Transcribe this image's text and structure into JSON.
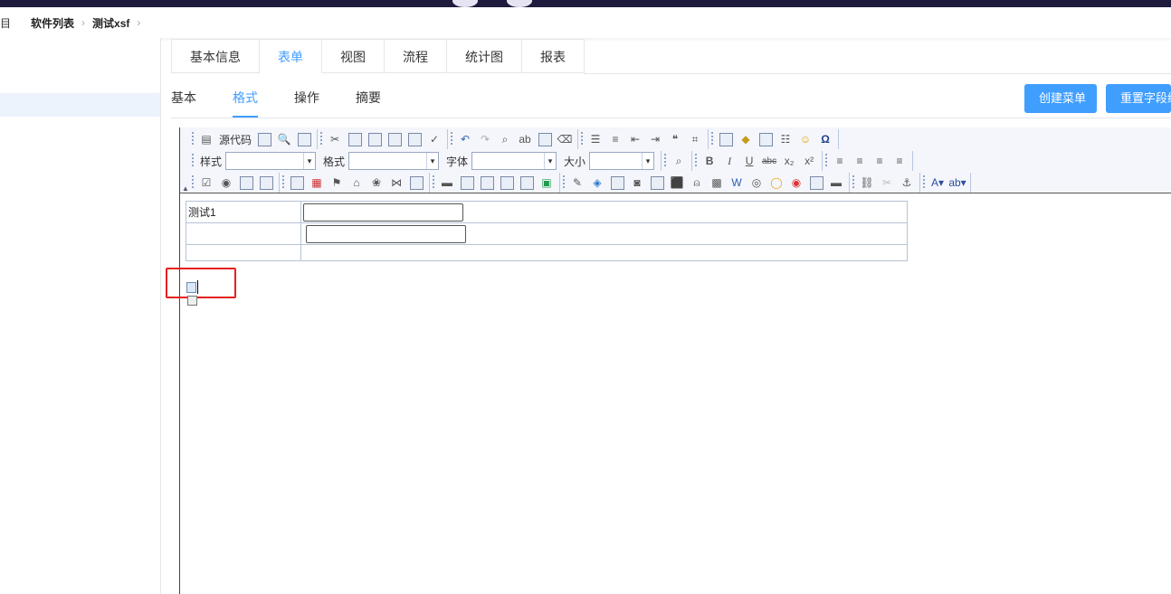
{
  "breadcrumb": {
    "first": "目",
    "items": [
      "软件列表",
      "测试xsf"
    ]
  },
  "tabs_primary": [
    "基本信息",
    "表单",
    "视图",
    "流程",
    "统计图",
    "报表"
  ],
  "tabs_primary_active": "表单",
  "tabs_secondary": [
    "基本",
    "格式",
    "操作",
    "摘要"
  ],
  "tabs_secondary_active": "格式",
  "buttons": {
    "create_menu": "创建菜单",
    "reset_fields": "重置字段编"
  },
  "toolbar": {
    "source_label": "源代码",
    "style_label": "样式",
    "format_label": "格式",
    "font_label": "字体",
    "size_label": "大小",
    "bold": "B",
    "italic": "I",
    "underline": "U",
    "strike": "abc",
    "subscript": "x₂",
    "superscript": "x²",
    "omega": "Ω",
    "quote": "❝"
  },
  "form_table": {
    "rows": [
      {
        "label": "测试1",
        "has_input": true
      },
      {
        "label": "",
        "has_input": true
      },
      {
        "label": "",
        "has_input": false
      }
    ]
  }
}
